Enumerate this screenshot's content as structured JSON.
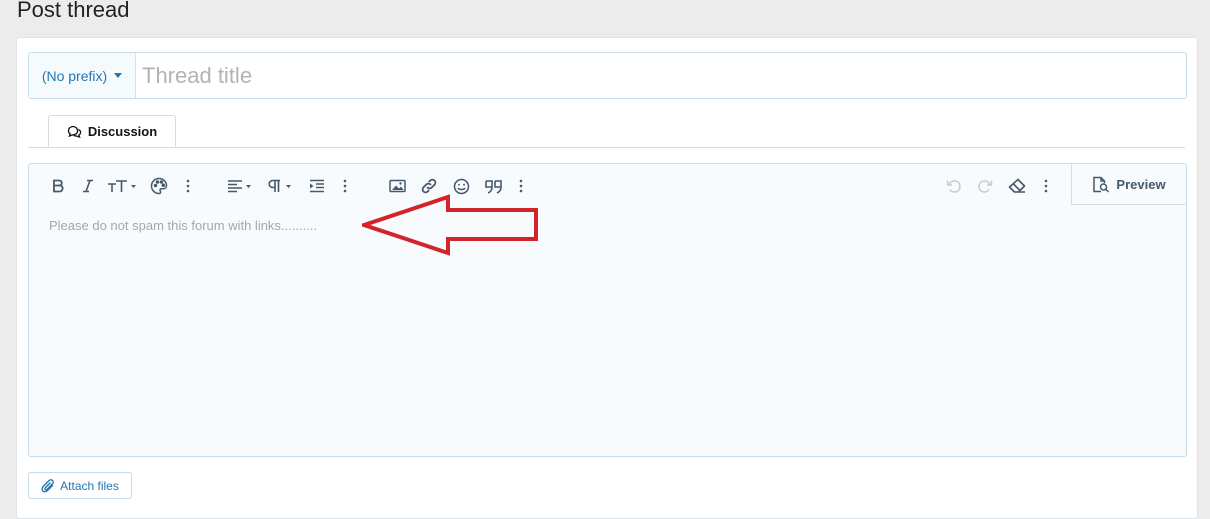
{
  "page": {
    "title": "Post thread"
  },
  "title_row": {
    "prefix_label": "(No prefix)",
    "title_placeholder": "Thread title",
    "title_value": ""
  },
  "tabs": [
    {
      "label": "Discussion",
      "active": true,
      "icon": "comments-icon"
    }
  ],
  "toolbar": {
    "left_groups": [
      [
        "bold-icon",
        "italic-icon",
        "font-size-icon",
        "text-color-icon",
        "more-options-icon"
      ],
      [
        "align-icon",
        "paragraph-icon",
        "indent-icon",
        "more-options-icon"
      ],
      [
        "image-icon",
        "link-icon",
        "smilie-icon",
        "quote-icon",
        "more-options-icon"
      ]
    ],
    "right_buttons": [
      "undo-icon",
      "redo-icon",
      "remove-format-icon",
      "more-options-icon"
    ],
    "preview_label": "Preview"
  },
  "editor": {
    "placeholder": "Please do not spam this forum with links.........."
  },
  "attach": {
    "label": "Attach files",
    "icon": "paperclip-icon"
  },
  "colors": {
    "accent": "#2577b1",
    "toolbar_icon": "#47586a",
    "annotation_arrow": "#d3242b",
    "editor_bg": "#f7fbfd"
  }
}
